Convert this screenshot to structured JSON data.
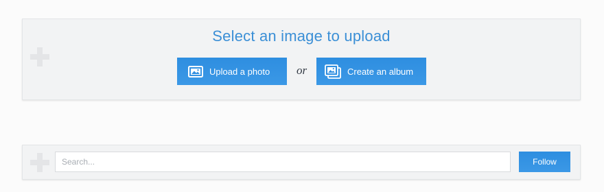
{
  "upload": {
    "title": "Select an image to upload",
    "upload_photo_label": "Upload a photo",
    "upload_photo_icon": "image-icon",
    "separator": "or",
    "create_album_label": "Create an album",
    "create_album_icon": "album-icon"
  },
  "search": {
    "placeholder": "Search...",
    "value": "",
    "follow_label": "Follow"
  },
  "colors": {
    "accent": "#2f8fe0",
    "title": "#3b8fd6",
    "panel_bg": "#f2f3f4",
    "plus_icon": "#e4e5e7"
  },
  "icons": {
    "add": "plus-icon"
  }
}
